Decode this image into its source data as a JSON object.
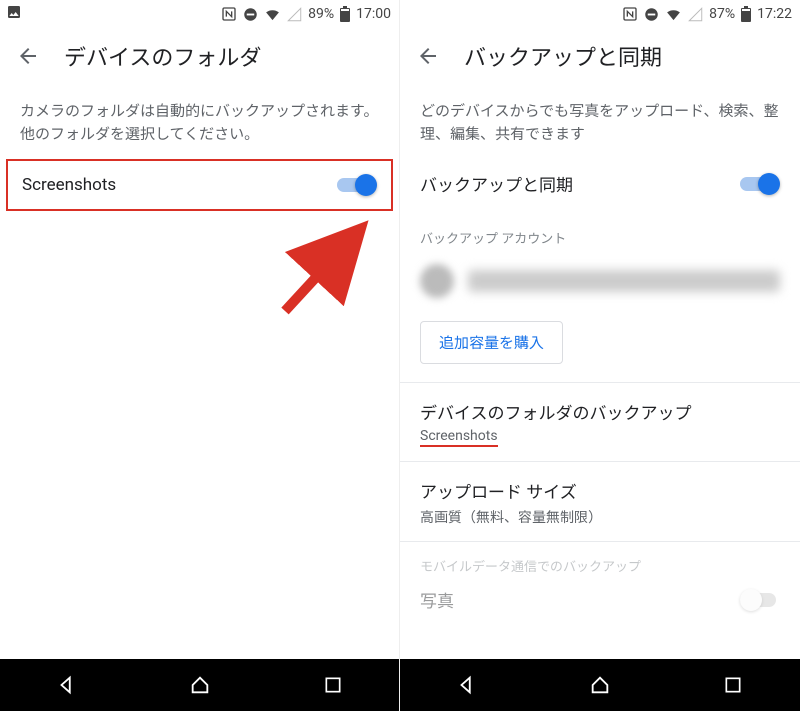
{
  "left": {
    "status": {
      "battery": "89%",
      "time": "17:00"
    },
    "title": "デバイスのフォルダ",
    "description": "カメラのフォルダは自動的にバックアップされます。他のフォルダを選択してください。",
    "folder_row": {
      "label": "Screenshots",
      "toggle_on": true
    }
  },
  "right": {
    "status": {
      "battery": "87%",
      "time": "17:22"
    },
    "title": "バックアップと同期",
    "description": "どのデバイスからでも写真をアップロード、検索、整理、編集、共有できます",
    "toggle_row": {
      "label": "バックアップと同期",
      "on": true
    },
    "account_label": "バックアップ アカウント",
    "buy_button": "追加容量を購入",
    "device_folder": {
      "title": "デバイスのフォルダのバックアップ",
      "sub": "Screenshots"
    },
    "upload_size": {
      "title": "アップロード サイズ",
      "sub": "高画質（無料、容量無制限）"
    },
    "mobile_label": "モバイルデータ通信でのバックアップ",
    "photo_label": "写真"
  }
}
